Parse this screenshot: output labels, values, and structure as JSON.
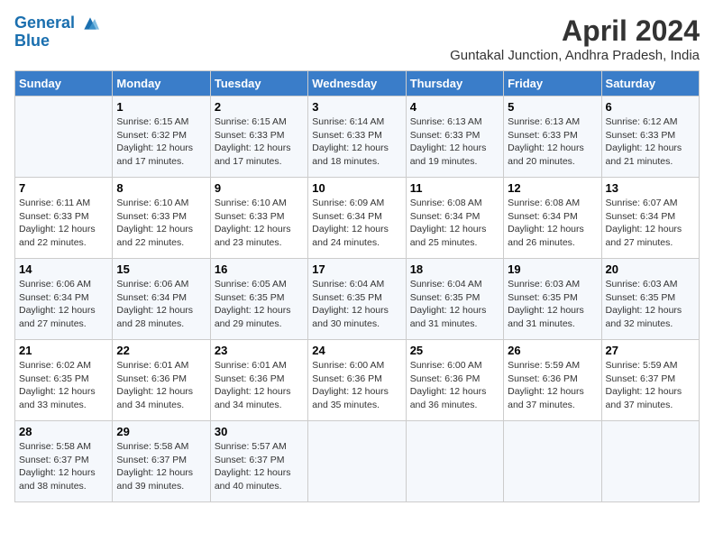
{
  "header": {
    "logo_line1": "General",
    "logo_line2": "Blue",
    "title": "April 2024",
    "subtitle": "Guntakal Junction, Andhra Pradesh, India"
  },
  "weekdays": [
    "Sunday",
    "Monday",
    "Tuesday",
    "Wednesday",
    "Thursday",
    "Friday",
    "Saturday"
  ],
  "weeks": [
    [
      {
        "day": "",
        "info": ""
      },
      {
        "day": "1",
        "info": "Sunrise: 6:15 AM\nSunset: 6:32 PM\nDaylight: 12 hours\nand 17 minutes."
      },
      {
        "day": "2",
        "info": "Sunrise: 6:15 AM\nSunset: 6:33 PM\nDaylight: 12 hours\nand 17 minutes."
      },
      {
        "day": "3",
        "info": "Sunrise: 6:14 AM\nSunset: 6:33 PM\nDaylight: 12 hours\nand 18 minutes."
      },
      {
        "day": "4",
        "info": "Sunrise: 6:13 AM\nSunset: 6:33 PM\nDaylight: 12 hours\nand 19 minutes."
      },
      {
        "day": "5",
        "info": "Sunrise: 6:13 AM\nSunset: 6:33 PM\nDaylight: 12 hours\nand 20 minutes."
      },
      {
        "day": "6",
        "info": "Sunrise: 6:12 AM\nSunset: 6:33 PM\nDaylight: 12 hours\nand 21 minutes."
      }
    ],
    [
      {
        "day": "7",
        "info": "Sunrise: 6:11 AM\nSunset: 6:33 PM\nDaylight: 12 hours\nand 22 minutes."
      },
      {
        "day": "8",
        "info": "Sunrise: 6:10 AM\nSunset: 6:33 PM\nDaylight: 12 hours\nand 22 minutes."
      },
      {
        "day": "9",
        "info": "Sunrise: 6:10 AM\nSunset: 6:33 PM\nDaylight: 12 hours\nand 23 minutes."
      },
      {
        "day": "10",
        "info": "Sunrise: 6:09 AM\nSunset: 6:34 PM\nDaylight: 12 hours\nand 24 minutes."
      },
      {
        "day": "11",
        "info": "Sunrise: 6:08 AM\nSunset: 6:34 PM\nDaylight: 12 hours\nand 25 minutes."
      },
      {
        "day": "12",
        "info": "Sunrise: 6:08 AM\nSunset: 6:34 PM\nDaylight: 12 hours\nand 26 minutes."
      },
      {
        "day": "13",
        "info": "Sunrise: 6:07 AM\nSunset: 6:34 PM\nDaylight: 12 hours\nand 27 minutes."
      }
    ],
    [
      {
        "day": "14",
        "info": "Sunrise: 6:06 AM\nSunset: 6:34 PM\nDaylight: 12 hours\nand 27 minutes."
      },
      {
        "day": "15",
        "info": "Sunrise: 6:06 AM\nSunset: 6:34 PM\nDaylight: 12 hours\nand 28 minutes."
      },
      {
        "day": "16",
        "info": "Sunrise: 6:05 AM\nSunset: 6:35 PM\nDaylight: 12 hours\nand 29 minutes."
      },
      {
        "day": "17",
        "info": "Sunrise: 6:04 AM\nSunset: 6:35 PM\nDaylight: 12 hours\nand 30 minutes."
      },
      {
        "day": "18",
        "info": "Sunrise: 6:04 AM\nSunset: 6:35 PM\nDaylight: 12 hours\nand 31 minutes."
      },
      {
        "day": "19",
        "info": "Sunrise: 6:03 AM\nSunset: 6:35 PM\nDaylight: 12 hours\nand 31 minutes."
      },
      {
        "day": "20",
        "info": "Sunrise: 6:03 AM\nSunset: 6:35 PM\nDaylight: 12 hours\nand 32 minutes."
      }
    ],
    [
      {
        "day": "21",
        "info": "Sunrise: 6:02 AM\nSunset: 6:35 PM\nDaylight: 12 hours\nand 33 minutes."
      },
      {
        "day": "22",
        "info": "Sunrise: 6:01 AM\nSunset: 6:36 PM\nDaylight: 12 hours\nand 34 minutes."
      },
      {
        "day": "23",
        "info": "Sunrise: 6:01 AM\nSunset: 6:36 PM\nDaylight: 12 hours\nand 34 minutes."
      },
      {
        "day": "24",
        "info": "Sunrise: 6:00 AM\nSunset: 6:36 PM\nDaylight: 12 hours\nand 35 minutes."
      },
      {
        "day": "25",
        "info": "Sunrise: 6:00 AM\nSunset: 6:36 PM\nDaylight: 12 hours\nand 36 minutes."
      },
      {
        "day": "26",
        "info": "Sunrise: 5:59 AM\nSunset: 6:36 PM\nDaylight: 12 hours\nand 37 minutes."
      },
      {
        "day": "27",
        "info": "Sunrise: 5:59 AM\nSunset: 6:37 PM\nDaylight: 12 hours\nand 37 minutes."
      }
    ],
    [
      {
        "day": "28",
        "info": "Sunrise: 5:58 AM\nSunset: 6:37 PM\nDaylight: 12 hours\nand 38 minutes."
      },
      {
        "day": "29",
        "info": "Sunrise: 5:58 AM\nSunset: 6:37 PM\nDaylight: 12 hours\nand 39 minutes."
      },
      {
        "day": "30",
        "info": "Sunrise: 5:57 AM\nSunset: 6:37 PM\nDaylight: 12 hours\nand 40 minutes."
      },
      {
        "day": "",
        "info": ""
      },
      {
        "day": "",
        "info": ""
      },
      {
        "day": "",
        "info": ""
      },
      {
        "day": "",
        "info": ""
      }
    ]
  ]
}
